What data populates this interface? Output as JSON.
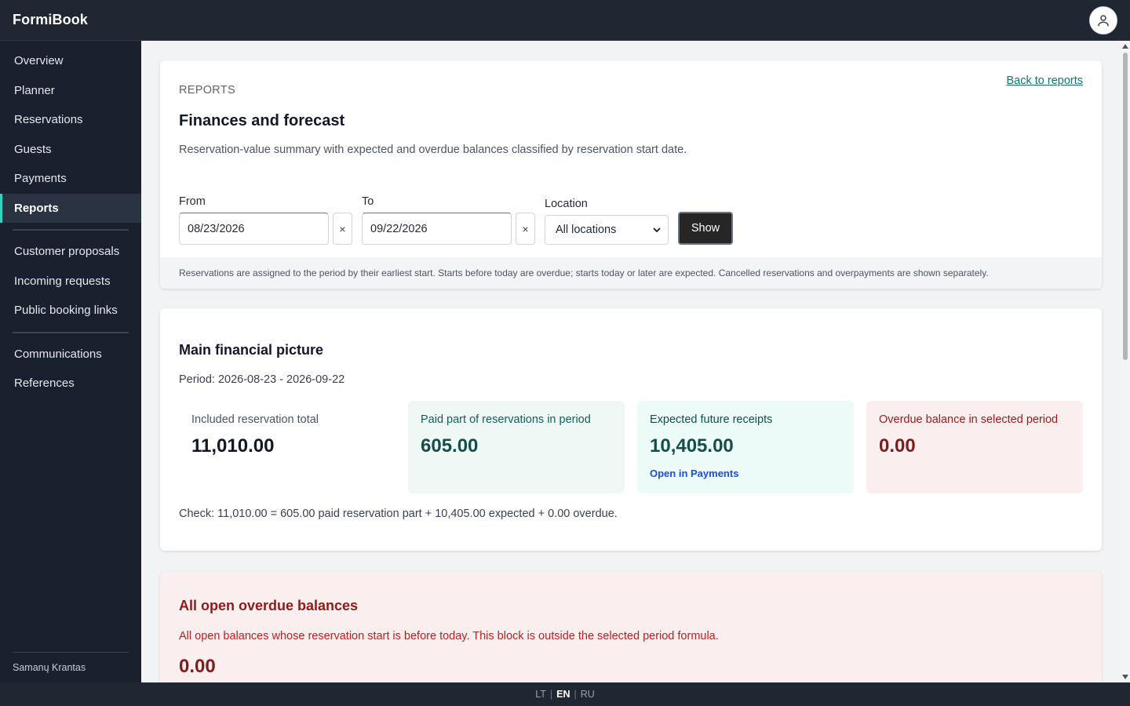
{
  "app": {
    "title": "FormiBook"
  },
  "sidebar": {
    "items": [
      {
        "label": "Overview"
      },
      {
        "label": "Planner"
      },
      {
        "label": "Reservations"
      },
      {
        "label": "Guests"
      },
      {
        "label": "Payments"
      },
      {
        "label": "Reports",
        "active": true
      }
    ],
    "items2": [
      {
        "label": "Customer proposals"
      },
      {
        "label": "Incoming requests"
      },
      {
        "label": "Public booking links"
      }
    ],
    "items3": [
      {
        "label": "Communications"
      },
      {
        "label": "References"
      }
    ],
    "footer": "Samanų Krantas"
  },
  "languages": {
    "lt": "LT",
    "en": "EN",
    "ru": "RU",
    "active": "EN",
    "separator": "|"
  },
  "header_card": {
    "eyebrow": "REPORTS",
    "back_link": "Back to reports",
    "title": "Finances and forecast",
    "description": "Reservation-value summary with expected and overdue balances classified by reservation start date.",
    "from_label": "From",
    "from_value": "08/23/2026",
    "to_label": "To",
    "to_value": "09/22/2026",
    "clear_glyph": "×",
    "location_label": "Location",
    "location_value": "All locations",
    "show_button": "Show",
    "note": "Reservations are assigned to the period by their earliest start. Starts before today are overdue; starts today or later are expected. Cancelled reservations and overpayments are shown separately."
  },
  "main_card": {
    "title": "Main financial picture",
    "period": "Period: 2026-08-23 - 2026-09-22",
    "kpis": [
      {
        "label": "Included reservation total",
        "value": "11,010.00"
      },
      {
        "label": "Paid part of reservations in period",
        "value": "605.00"
      },
      {
        "label": "Expected future receipts",
        "value": "10,405.00",
        "link": "Open in Payments"
      },
      {
        "label": "Overdue balance in selected period",
        "value": "0.00"
      }
    ],
    "check": "Check: 11,010.00 = 605.00 paid reservation part + 10,405.00 expected + 0.00 overdue."
  },
  "overdue_card": {
    "title": "All open overdue balances",
    "description": "All open balances whose reservation start is before today. This block is outside the selected period formula.",
    "value": "0.00"
  },
  "colors": {
    "sidebar_bg": "#19212f",
    "topbar_bg": "#1f2733",
    "accent": "#2dd4bf",
    "link": "#0f766e",
    "danger": "#7f1d1d"
  },
  "icons": {
    "user": "user-icon",
    "select": "chevron-down-icon"
  }
}
